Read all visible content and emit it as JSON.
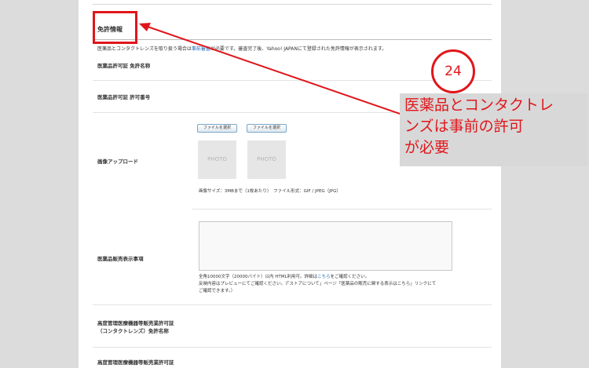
{
  "section": {
    "title": "免許情報",
    "note_prefix": "医薬品とコンタクトレンズを取り扱う場合は",
    "note_link": "事前審査",
    "note_suffix": "が必要です。審査完了後、Yahoo! JAPANにて登録された免許情報が表示されます。"
  },
  "fields": {
    "license_name_label": "医薬品許可証 免許名称",
    "license_number_label": "医薬品許可証 許可番号",
    "image_upload_label": "画像アップロード",
    "file_button_1": "ファイルを選択",
    "file_button_2": "ファイルを選択",
    "photo_1": "PHOTO",
    "photo_2": "PHOTO",
    "image_spec": "画像サイズ：3MBまで（1枚あたり）　ファイル形式：GIF / JPEG（JPG）",
    "sales_display_label": "医薬品販売表示事項",
    "textarea_value": "",
    "help_line1_prefix": "全角10000文字（20000バイト）以内 HTML利用可。詳細は",
    "help_line1_link": "こちら",
    "help_line1_suffix": "をご確認ください。",
    "help_line2": "反映内容はプレビューにてご確認ください。（「ストアについて」ページ「医薬品の販売に関する表示はこちら」リンクにて",
    "help_line3": "ご確認できます。）",
    "device_license_label_line1": "高度管理医療機器等販売業許可証",
    "device_license_label_line2": "（コンタクトレンズ）免許名称",
    "device_license2_label": "高度管理医療機器等販売業許可証"
  },
  "annotation": {
    "badge_number": "24",
    "callout_line1": "医薬品とコンタクトレ",
    "callout_line2": "ンズは事前の許可",
    "callout_line3": "が必要",
    "highlight_color": "#e0161b",
    "callout_bg": "#d8d8d8"
  }
}
